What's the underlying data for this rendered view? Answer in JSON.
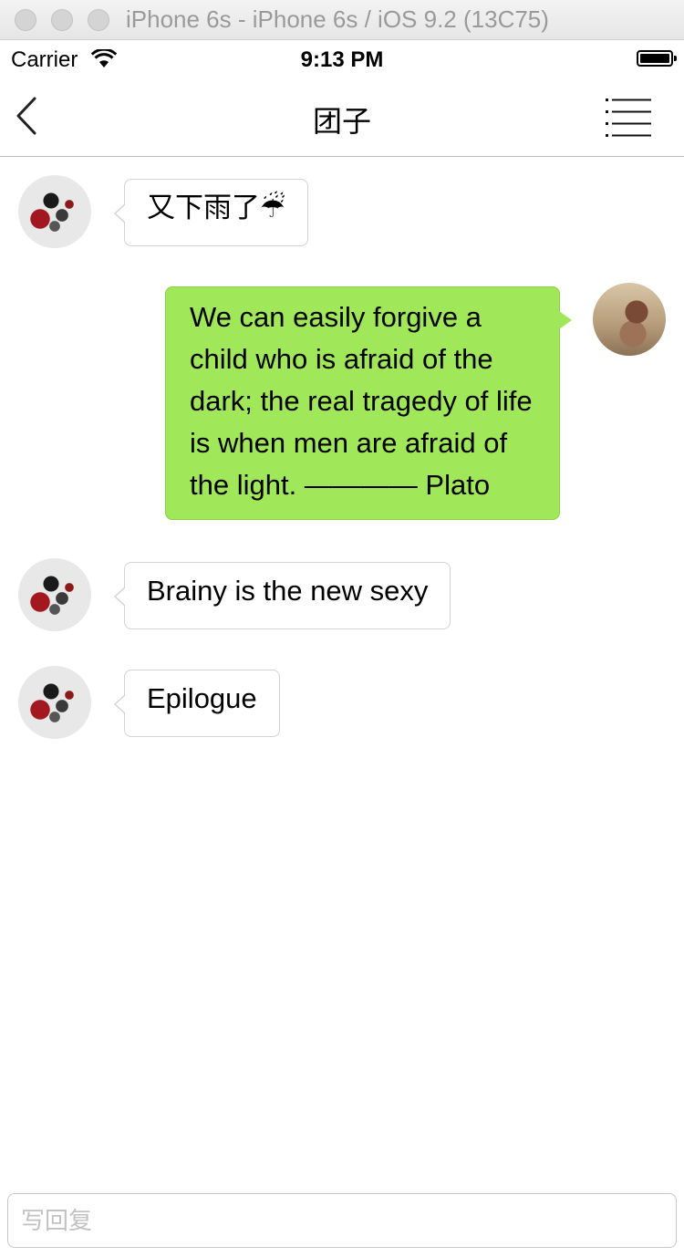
{
  "window": {
    "title": "iPhone 6s - iPhone 6s / iOS 9.2 (13C75)"
  },
  "status_bar": {
    "carrier": "Carrier",
    "time": "9:13 PM",
    "wifi_icon": "wifi-icon",
    "battery_icon": "battery-icon"
  },
  "nav": {
    "title": "团子",
    "back_icon": "chevron-left-icon",
    "menu_icon": "list-icon"
  },
  "messages": [
    {
      "direction": "incoming",
      "text": "又下雨了☔"
    },
    {
      "direction": "outgoing",
      "text": "We can easily forgive a child who is afraid of the dark; the real tragedy of life is when men are afraid of the light. ———— Plato"
    },
    {
      "direction": "incoming",
      "text": "Brainy is the new sexy"
    },
    {
      "direction": "incoming",
      "text": "Epilogue"
    }
  ],
  "input": {
    "placeholder": "写回复",
    "value": ""
  },
  "colors": {
    "outgoing_bubble": "#a0e75a",
    "incoming_bubble": "#ffffff",
    "bubble_border": "#d3d3d3"
  }
}
